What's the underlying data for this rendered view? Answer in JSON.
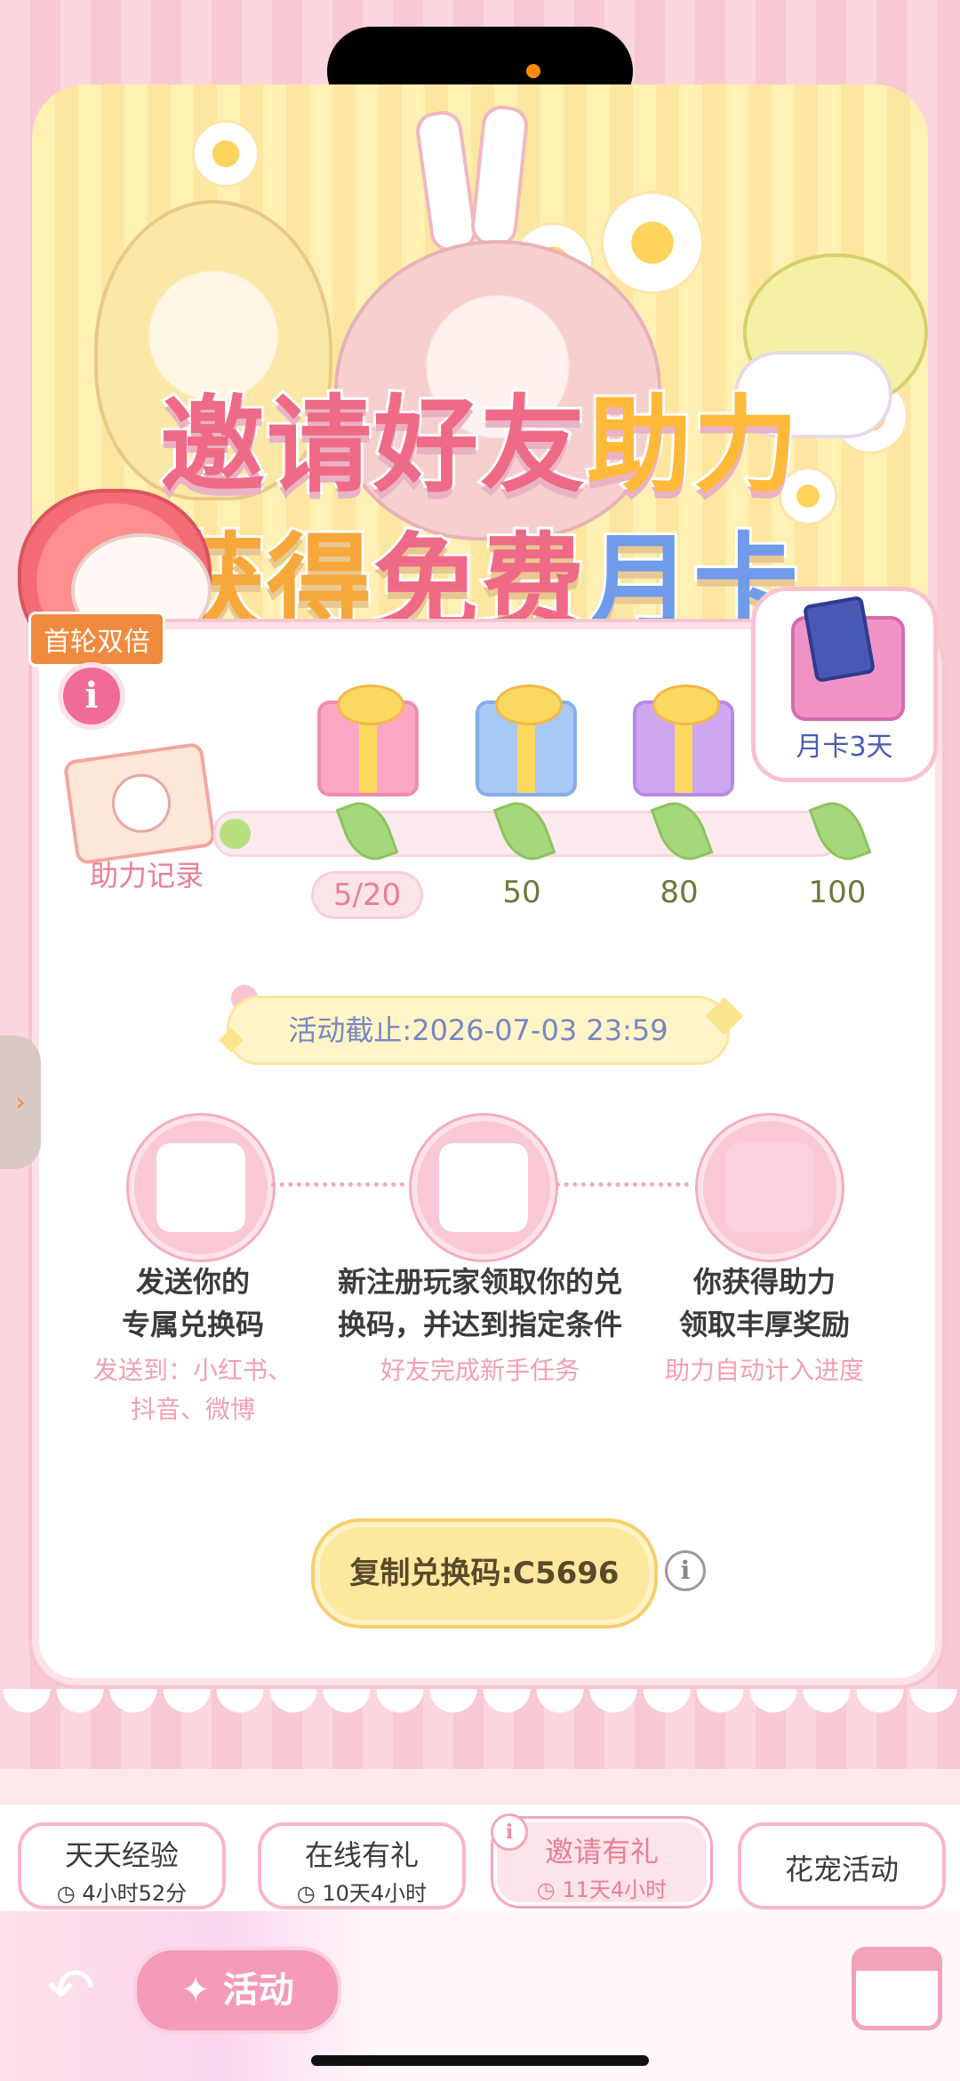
{
  "banner": {
    "title_line1_part1": "邀请好友",
    "title_line1_part2": "助力",
    "title_line2_part1": "获得",
    "title_line2_part2": "免费",
    "title_line2_part3": "月卡"
  },
  "badge_double": "首轮双倍",
  "info_icon": "i",
  "record_label": "助力记录",
  "reward_card_label": "月卡3天",
  "progress": {
    "current": 5,
    "max": 100,
    "fraction": 0.05,
    "milestones": [
      "5/20",
      "50",
      "80",
      "100"
    ]
  },
  "deadline_text": "活动截止:2026-07-03 23:59",
  "steps": [
    {
      "title_line1": "发送你的",
      "title_line2": "专属兑换码",
      "sub_line1": "发送到：小红书、",
      "sub_line2": "抖音、微博"
    },
    {
      "title_line1": "新注册玩家领取你的兑",
      "title_line2": "换码，并达到指定条件",
      "sub_line1": "好友完成新手任务",
      "sub_line2": ""
    },
    {
      "title_line1": "你获得助力",
      "title_line2": "领取丰厚奖励",
      "sub_line1": "助力自动计入进度",
      "sub_line2": ""
    }
  ],
  "copy_button": "复制兑换码:C5696",
  "tabs": [
    {
      "label": "天天经验",
      "time": "4小时52分"
    },
    {
      "label": "在线有礼",
      "time": "10天4小时"
    },
    {
      "label": "邀请有礼",
      "time": "11天4小时"
    },
    {
      "label": "花宠活动",
      "time": ""
    }
  ],
  "activity_button": "活动",
  "back_icon": "↶",
  "colors": {
    "accent_pink": "#f59ab9",
    "title_pink": "#ef6a86",
    "title_yellow": "#ffb938",
    "title_blue": "#6f9bea"
  },
  "icons": [
    "info-icon",
    "back-arrow-icon",
    "calendar-icon",
    "gift-icon",
    "leaf-icon",
    "sparkle-icon",
    "clock-icon"
  ]
}
